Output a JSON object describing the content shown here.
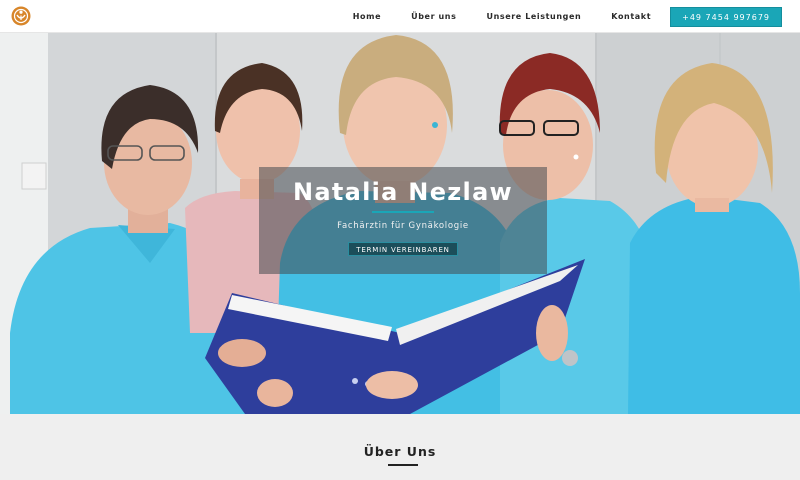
{
  "header": {
    "logo_icon": "stylized-figure-logo-icon",
    "brand_color": "#d8862a",
    "nav": [
      {
        "label": "Home"
      },
      {
        "label": "Über uns"
      },
      {
        "label": "Unsere Leistungen"
      },
      {
        "label": "Kontakt"
      }
    ],
    "phone_button": "+49 7454 997679",
    "accent_color": "#1aa6b7"
  },
  "hero": {
    "title": "Natalia Nezlaw",
    "subtitle": "Fachärztin für Gynäkologie",
    "cta": "TERMIN VEREINBAREN",
    "image": "team-photo-five-women-turquoise-polo-shirts-holding-blue-folder"
  },
  "about": {
    "title": "Über Uns"
  }
}
